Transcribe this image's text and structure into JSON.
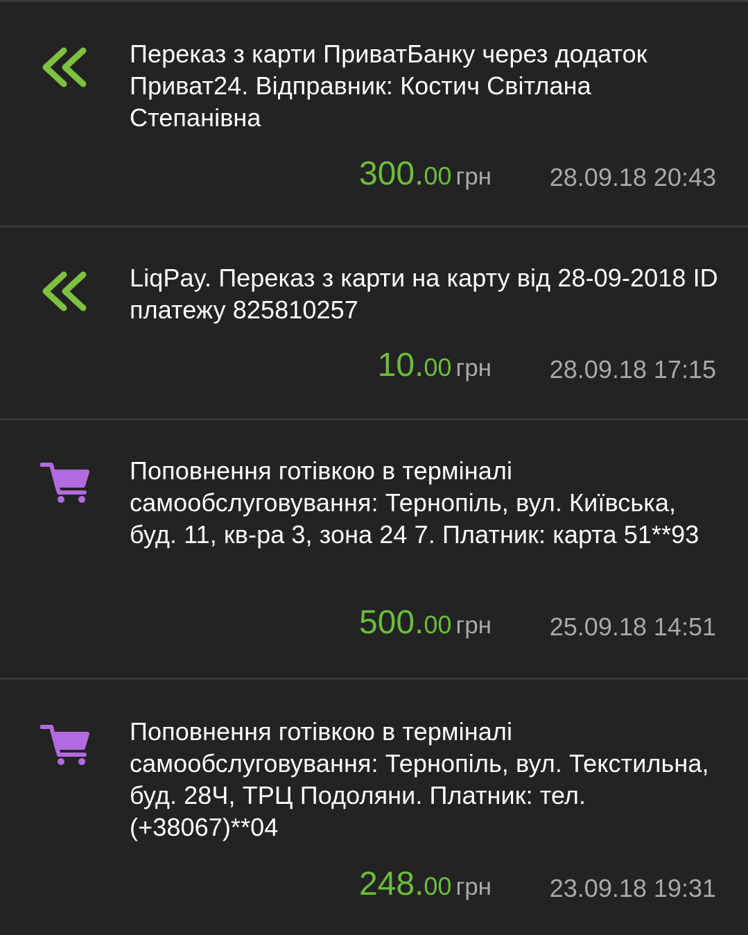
{
  "colors": {
    "background": "#232323",
    "divider": "#3a3a3a",
    "amount_green": "#6cbd3b",
    "incoming_icon_green": "#7ec141",
    "cart_icon_purple": "#b36ae0",
    "secondary_text": "#a9a9a9"
  },
  "transactions": [
    {
      "icon": "double-chevron-left-icon",
      "description": "Переказ з карти ПриватБанку через додаток Приват24. Відправник: Костич Світлана Степанівна",
      "amount_int": "300.",
      "amount_dec": "00",
      "currency": "грн",
      "datetime": "28.09.18 20:43"
    },
    {
      "icon": "double-chevron-left-icon",
      "description": "LiqPay. Переказ з карти на карту від 28-09-2018 ID платежу 825810257",
      "amount_int": "10.",
      "amount_dec": "00",
      "currency": "грн",
      "datetime": "28.09.18 17:15"
    },
    {
      "icon": "shopping-cart-icon",
      "description": "Поповнення готівкою в терміналі самообслуговування: Тернопіль, вул. Київська, буд. 11, кв-ра 3, зона 24 7. Платник: карта 51**93",
      "amount_int": "500.",
      "amount_dec": "00",
      "currency": "грн",
      "datetime": "25.09.18 14:51"
    },
    {
      "icon": "shopping-cart-icon",
      "description": "Поповнення готівкою в терміналі самообслуговування: Тернопіль, вул. Текстильна, буд. 28Ч, ТРЦ Подоляни. Платник: тел. (+38067)**04",
      "amount_int": "248.",
      "amount_dec": "00",
      "currency": "грн",
      "datetime": "23.09.18 19:31"
    }
  ]
}
